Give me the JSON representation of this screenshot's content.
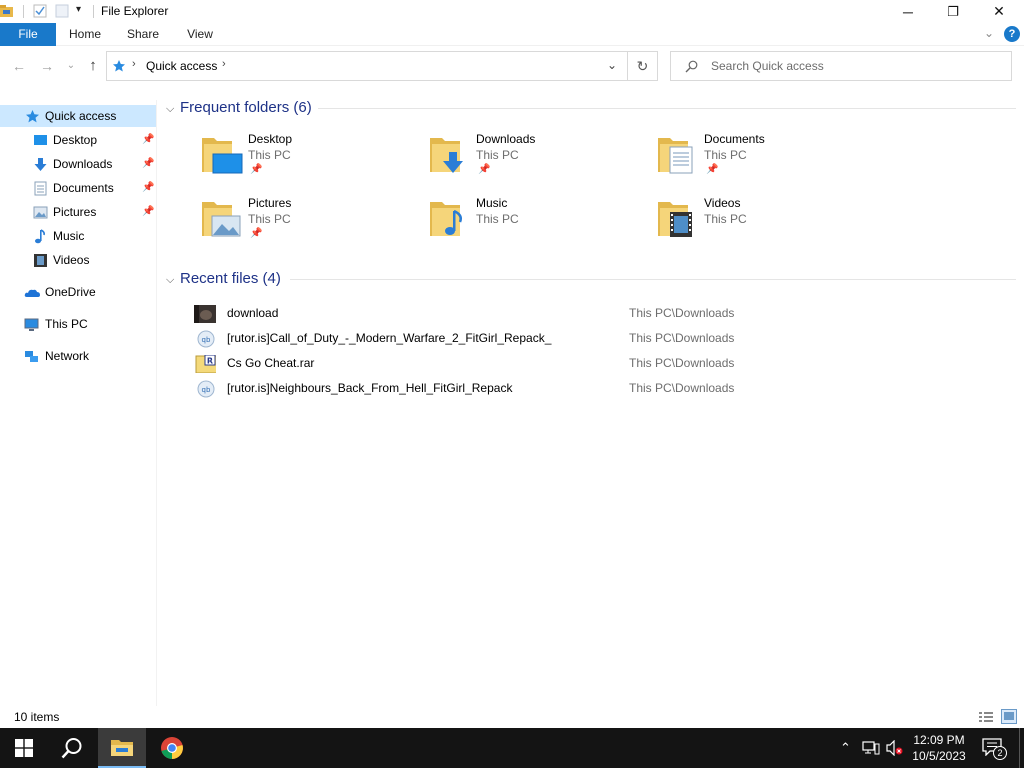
{
  "window": {
    "title": "File Explorer",
    "controls": {
      "minimize": "─",
      "maximize": "❐",
      "close": "✕"
    }
  },
  "ribbon": {
    "tabs": [
      {
        "label": "File"
      },
      {
        "label": "Home"
      },
      {
        "label": "Share"
      },
      {
        "label": "View"
      }
    ]
  },
  "navigation": {
    "back": "←",
    "forward": "→",
    "recent": "⌄",
    "up": "↑",
    "address": {
      "path": "Quick access"
    },
    "refresh": "↻",
    "search_placeholder": "Search Quick access"
  },
  "sidebar": {
    "items": [
      {
        "label": "Quick access",
        "icon": "star-icon",
        "selected": true
      },
      {
        "label": "Desktop",
        "icon": "desktop-icon",
        "pinned": true
      },
      {
        "label": "Downloads",
        "icon": "downloads-icon",
        "pinned": true
      },
      {
        "label": "Documents",
        "icon": "documents-icon",
        "pinned": true
      },
      {
        "label": "Pictures",
        "icon": "pictures-icon",
        "pinned": true
      },
      {
        "label": "Music",
        "icon": "music-icon"
      },
      {
        "label": "Videos",
        "icon": "videos-icon"
      },
      {
        "label": "OneDrive",
        "icon": "cloud-icon"
      },
      {
        "label": "This PC",
        "icon": "computer-icon"
      },
      {
        "label": "Network",
        "icon": "network-icon"
      }
    ]
  },
  "frequent": {
    "heading": "Frequent folders (6)",
    "folders": [
      {
        "name": "Desktop",
        "location": "This PC",
        "pinned": true
      },
      {
        "name": "Downloads",
        "location": "This PC",
        "pinned": true
      },
      {
        "name": "Documents",
        "location": "This PC",
        "pinned": true
      },
      {
        "name": "Pictures",
        "location": "This PC",
        "pinned": true
      },
      {
        "name": "Music",
        "location": "This PC",
        "pinned": false
      },
      {
        "name": "Videos",
        "location": "This PC",
        "pinned": false
      }
    ]
  },
  "recent": {
    "heading": "Recent files (4)",
    "files": [
      {
        "name": "download",
        "location": "This PC\\Downloads",
        "icon": "image-thumbnail-icon"
      },
      {
        "name": "[rutor.is]Call_of_Duty_-_Modern_Warfare_2_FitGirl_Repack_",
        "location": "This PC\\Downloads",
        "icon": "torrent-icon"
      },
      {
        "name": "Cs Go Cheat.rar",
        "location": "This PC\\Downloads",
        "icon": "rar-archive-icon"
      },
      {
        "name": "[rutor.is]Neighbours_Back_From_Hell_FitGirl_Repack",
        "location": "This PC\\Downloads",
        "icon": "torrent-icon"
      }
    ]
  },
  "status": {
    "item_count": "10 items"
  },
  "taskbar": {
    "time": "12:09 PM",
    "date": "10/5/2023",
    "notification_count": "2"
  },
  "colors": {
    "accent": "#1979ca",
    "selection": "#cce8ff",
    "heading": "#1e3287",
    "taskbar": "#141414"
  }
}
